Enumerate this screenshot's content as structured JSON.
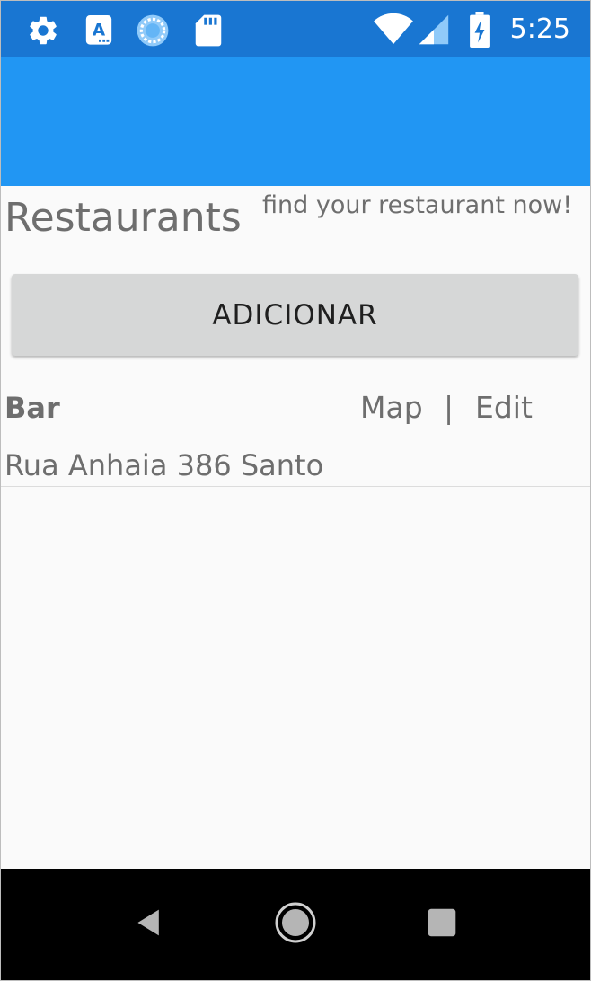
{
  "status_bar": {
    "time": "5:25",
    "left_icons": [
      "gear-icon",
      "text-a-icon",
      "sync-circle-icon",
      "sd-card-icon"
    ],
    "right_icons": [
      "wifi-icon",
      "cell-signal-icon",
      "battery-charging-icon"
    ],
    "color": "#1976d2"
  },
  "app_bar": {
    "color": "#2196f3"
  },
  "header": {
    "title": "Restaurants",
    "tagline": "find your restaurant now!"
  },
  "add_button": {
    "label": "ADICIONAR"
  },
  "restaurants": [
    {
      "name": "Bar",
      "map_label": "Map",
      "separator": "|",
      "edit_label": "Edit",
      "address": "Rua Anhaia 386 Santo"
    }
  ],
  "nav_bar": {
    "buttons": [
      "back-icon",
      "home-icon",
      "recents-icon"
    ]
  }
}
